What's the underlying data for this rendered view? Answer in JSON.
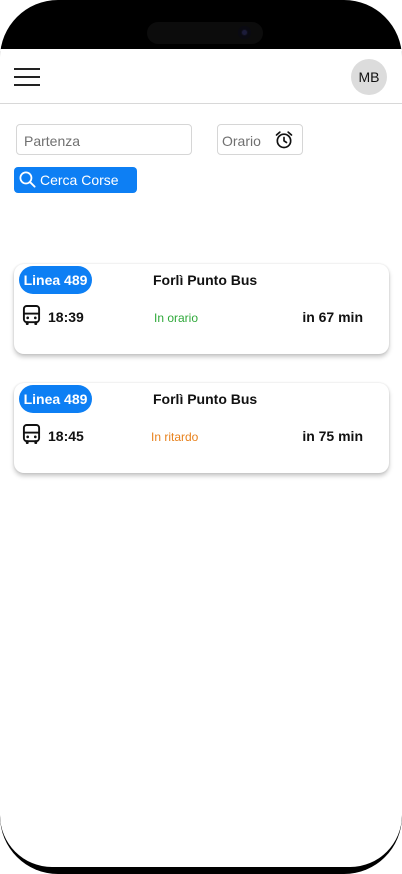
{
  "header": {
    "menu_icon": "hamburger-menu-icon",
    "avatar_initials": "MB"
  },
  "search": {
    "departure_placeholder": "Partenza",
    "time_placeholder": "Orario",
    "time_icon": "alarm-clock-icon",
    "button_label": "Cerca Corse",
    "button_icon": "search-icon"
  },
  "colors": {
    "accent": "#0d7ff4",
    "on_time": "#2fa93a",
    "delayed": "#e8821d"
  },
  "results": [
    {
      "line": "Linea 489",
      "destination": "Forlì Punto Bus",
      "time": "18:39",
      "status": "In orario",
      "status_type": "on_time",
      "eta": "in 67 min",
      "icon": "bus-icon"
    },
    {
      "line": "Linea 489",
      "destination": "Forlì Punto Bus",
      "time": "18:45",
      "status": "In ritardo",
      "status_type": "delayed",
      "eta": "in 75 min",
      "icon": "bus-icon"
    }
  ]
}
